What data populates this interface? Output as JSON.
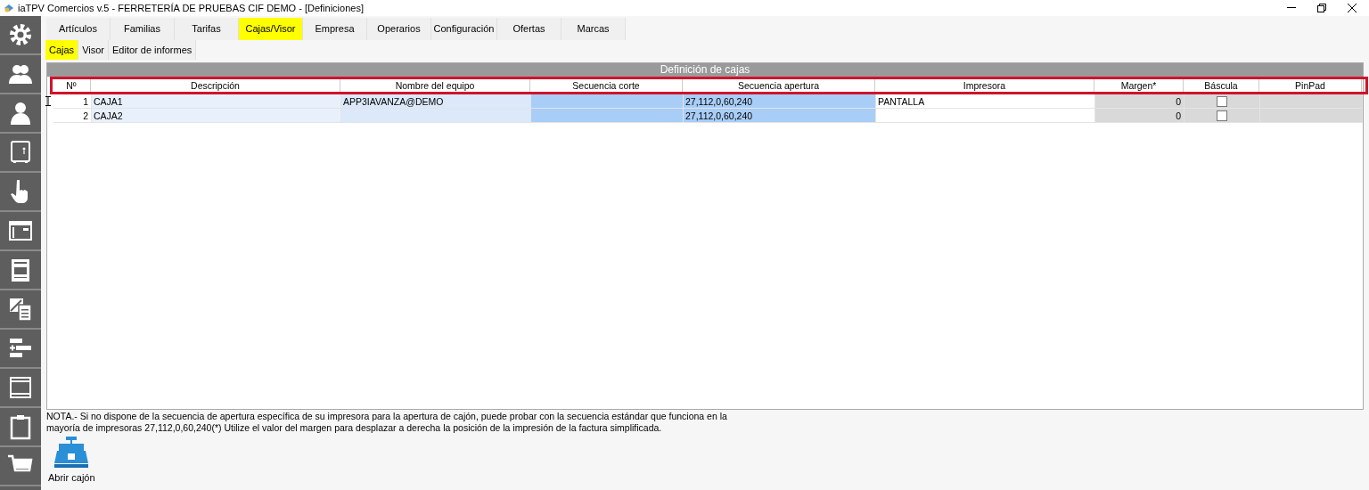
{
  "window": {
    "title": "iaTPV Comercios v.5 - FERRETERÍA DE PRUEBAS CIF DEMO - [Definiciones]"
  },
  "sidebar": {
    "items": [
      {
        "kind": "gear"
      },
      {
        "kind": "users"
      },
      {
        "kind": "user"
      },
      {
        "kind": "safe"
      },
      {
        "kind": "hand"
      },
      {
        "kind": "window"
      },
      {
        "kind": "receipt"
      },
      {
        "kind": "clipboard-edit"
      },
      {
        "kind": "form"
      },
      {
        "kind": "panel"
      },
      {
        "kind": "clipboard"
      },
      {
        "kind": "cart"
      }
    ]
  },
  "tabs": [
    {
      "label": "Artículos",
      "selected": false
    },
    {
      "label": "Familias",
      "selected": false
    },
    {
      "label": "Tarifas",
      "selected": false
    },
    {
      "label": "Cajas/Visor",
      "selected": true
    },
    {
      "label": "Empresa",
      "selected": false
    },
    {
      "label": "Operarios",
      "selected": false
    },
    {
      "label": "Configuración",
      "selected": false
    },
    {
      "label": "Ofertas",
      "selected": false
    },
    {
      "label": "Marcas",
      "selected": false
    }
  ],
  "subtabs": [
    {
      "label": "Cajas",
      "selected": true
    },
    {
      "label": "Visor",
      "selected": false
    },
    {
      "label": "Editor de informes",
      "selected": false
    }
  ],
  "table": {
    "title": "Definición de cajas",
    "columns": [
      {
        "label": "Nº",
        "kind": "num"
      },
      {
        "label": "Descripción",
        "kind": "desc"
      },
      {
        "label": "Nombre del equipo",
        "kind": "name"
      },
      {
        "label": "Secuencia corte",
        "kind": "seq"
      },
      {
        "label": "Secuencia apertura",
        "kind": "seq"
      },
      {
        "label": "Impresora",
        "kind": "plain"
      },
      {
        "label": "Margen*",
        "kind": "numgray"
      },
      {
        "label": "Báscula",
        "kind": "check"
      },
      {
        "label": "PinPad",
        "kind": "gray"
      }
    ],
    "rows": [
      {
        "current": true,
        "cells": [
          "1",
          "CAJA1",
          "APP3IAVANZA@DEMO",
          "",
          "27,112,0,60,240",
          "PANTALLA",
          "0",
          {
            "checked": false
          },
          ""
        ]
      },
      {
        "current": false,
        "cells": [
          "2",
          "CAJA2",
          "",
          "",
          "27,112,0,60,240",
          "",
          "0",
          {
            "checked": false
          },
          ""
        ]
      }
    ]
  },
  "note": "NOTA.- Si no dispone de la secuencia de apertura específica de su impresora para la apertura de cajón, puede probar con la secuencia estándar que funciona en la mayoría de impresoras 27,112,0,60,240(*) Utilize el valor del margen  para desplazar a derecha la posición de la impresión de la factura simplificada.",
  "buttons": [
    {
      "label": "Abrir cajón"
    }
  ]
}
